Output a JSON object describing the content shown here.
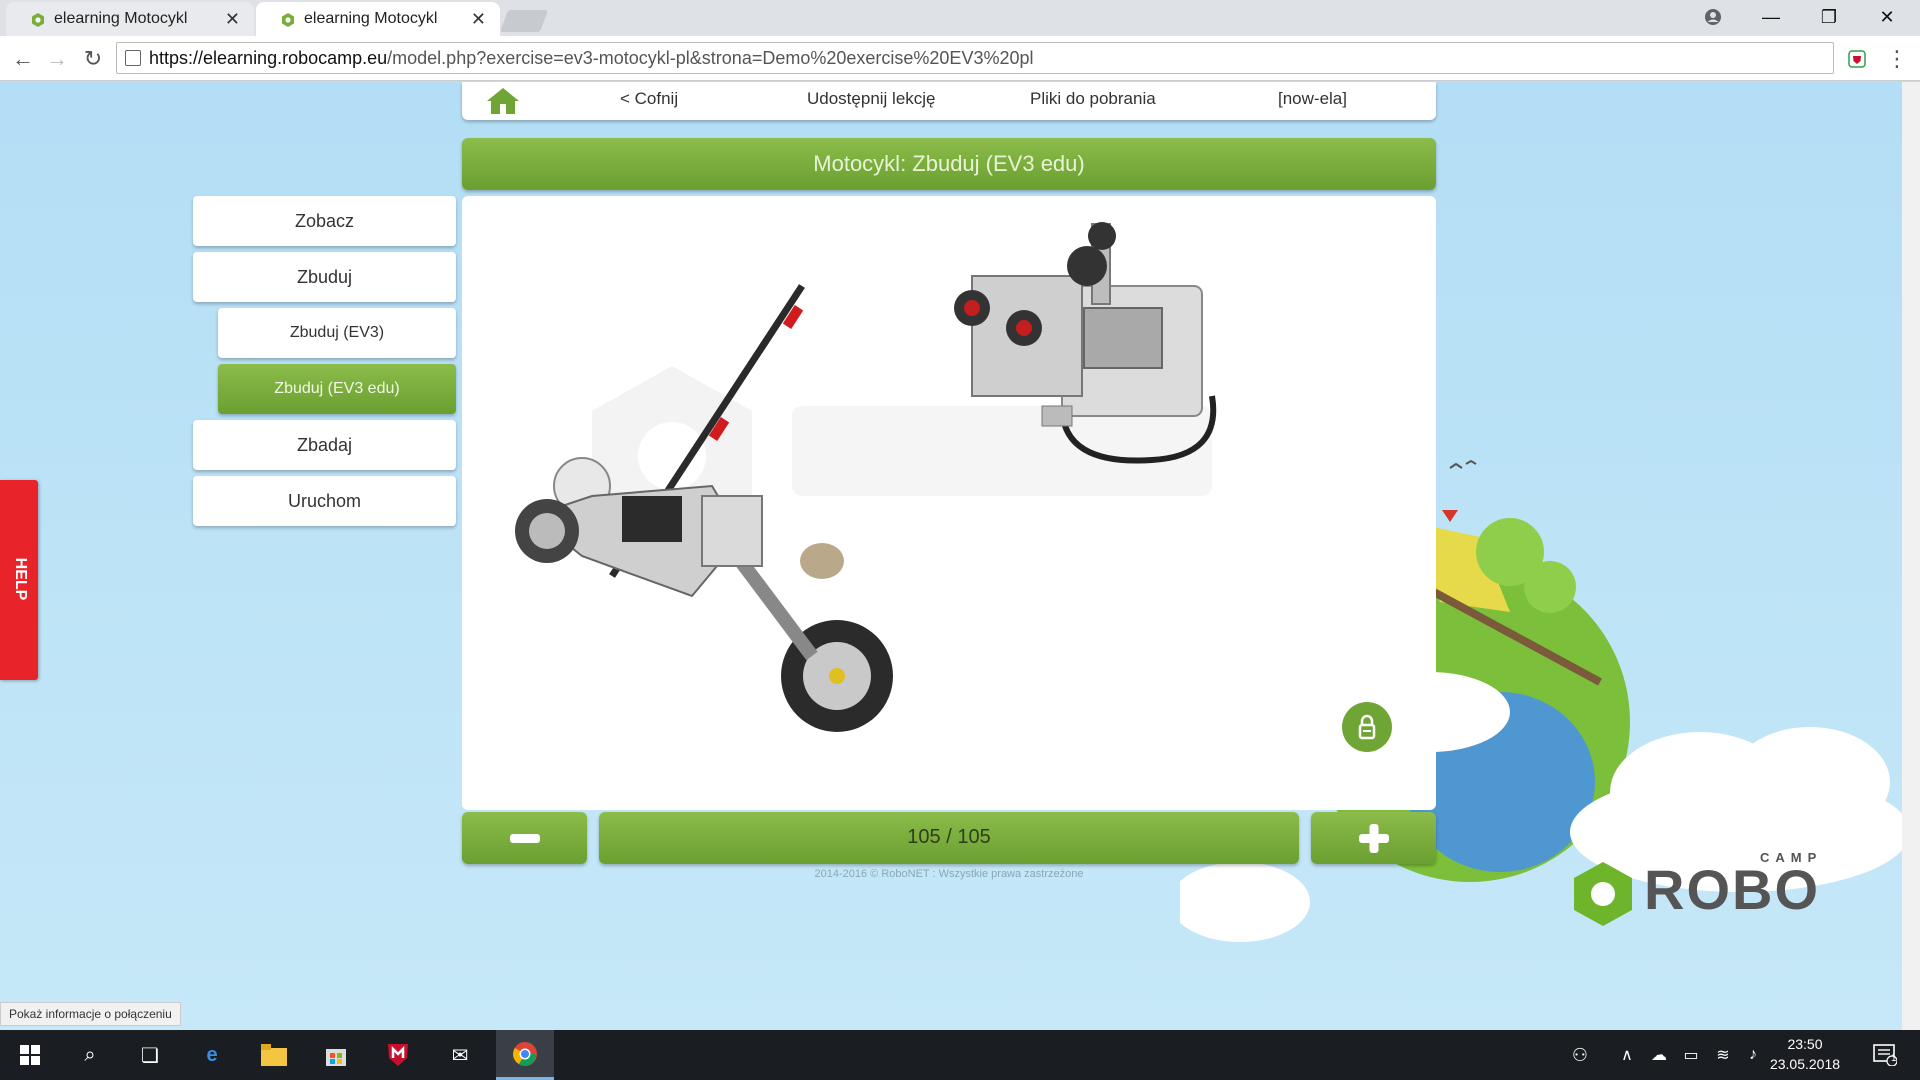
{
  "browser": {
    "tabs": [
      {
        "title": "elearning Motocykl",
        "active": false
      },
      {
        "title": "elearning Motocykl",
        "active": true
      }
    ],
    "url_host": "https://elearning.robocamp.eu",
    "url_path": "/model.php?exercise=ev3-motocykl-pl&strona=Demo%20exercise%20EV3%20pl",
    "status_text": "Pokaż informacje o połączeniu"
  },
  "topnav": {
    "back": "< Cofnij",
    "share": "Udostępnij lekcję",
    "downloads": "Pliki do pobrania",
    "user": "[now-ela]"
  },
  "title": "Motocykl: Zbuduj (EV3 edu)",
  "sidebar": {
    "items": [
      {
        "label": "Zobacz",
        "level": "main",
        "selected": false
      },
      {
        "label": "Zbuduj",
        "level": "main",
        "selected": false
      },
      {
        "label": "Zbuduj (EV3)",
        "level": "sub",
        "selected": false
      },
      {
        "label": "Zbuduj (EV3 edu)",
        "level": "sub",
        "selected": true
      },
      {
        "label": "Zbadaj",
        "level": "main",
        "selected": false
      },
      {
        "label": "Uruchom",
        "level": "main",
        "selected": false
      }
    ]
  },
  "help": "HELP",
  "pager": {
    "counter": "105 / 105",
    "current": 105,
    "total": 105
  },
  "copyright": "2014-2016 © RoboNET : Wszystkie prawa zastrzeżone",
  "logo": {
    "small": "CAMP",
    "big": "ROBO"
  },
  "taskbar": {
    "time": "23:50",
    "date": "23.05.2018",
    "notifications": "1"
  },
  "colors": {
    "accent_green": "#7aad3c",
    "help_red": "#e8232a"
  }
}
